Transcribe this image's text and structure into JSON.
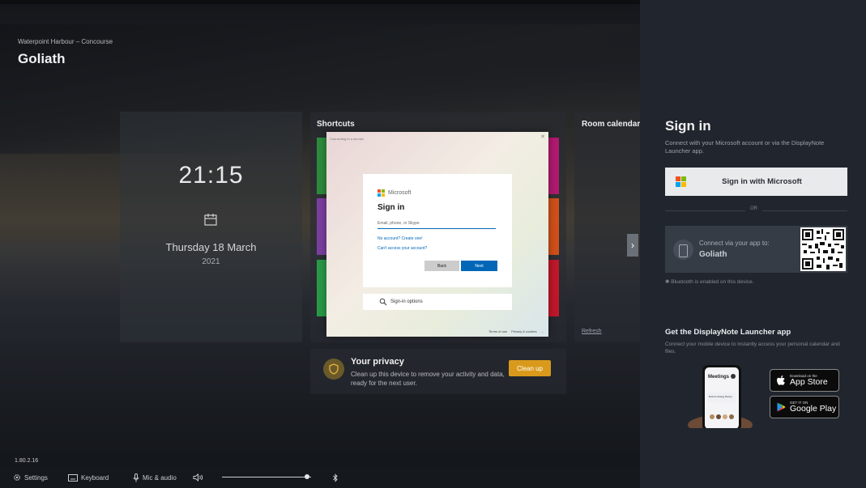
{
  "location": "Waterpoint Harbour – Concourse",
  "room_name": "Goliath",
  "clock": {
    "time": "21:15",
    "date": "Thursday 18 March",
    "year": "2021"
  },
  "shortcuts": {
    "title": "Shortcuts",
    "tile_colors": [
      "#2e8b3d",
      "#7b3fa0",
      "#2a9a48",
      "#b01a70",
      "#d0501a",
      "#c0182a"
    ]
  },
  "room_calendar": {
    "title": "Room calendar",
    "refresh": "Refresh"
  },
  "privacy": {
    "title": "Your privacy",
    "text": "Clean up this device to remove your activity and data, ready for the next user.",
    "button": "Clean up"
  },
  "version": "1.80.2.16",
  "bottombar": {
    "settings": "Settings",
    "keyboard": "Keyboard",
    "mic": "Mic & audio"
  },
  "volume_level": 0.95,
  "dialog": {
    "title": "Connecting to a service",
    "brand": "Microsoft",
    "heading": "Sign in",
    "input_placeholder": "Email, phone, or Skype",
    "no_account": "No account? Create one!",
    "cant_access": "Can't access your account?",
    "back": "Back",
    "next": "Next",
    "signin_options": "Sign-in options",
    "terms": "Terms of use",
    "privacy": "Privacy & cookies",
    "more": "..."
  },
  "panel": {
    "title": "Sign in",
    "subtitle": "Connect with your Microsoft account or via the DisplayNote Launcher app.",
    "ms_button": "Sign in with Microsoft",
    "or": "OR",
    "connect_text": "Connect via your app to:",
    "connect_room": "Goliath",
    "bluetooth_note": "Bluetooth is enabled on this device.",
    "app_title": "Get the DisplayNote Launcher app",
    "app_subtitle": "Connect your mobile device to instantly access your personal calendar and files.",
    "appstore_small": "Download on the",
    "appstore_big": "App Store",
    "googleplay_small": "GET IT ON",
    "googleplay_big": "Google Play",
    "mock_title": "Meetings",
    "mock_event": "Business Strategy Meeting"
  },
  "colors": {
    "ms_red": "#f25022",
    "ms_green": "#7fba00",
    "ms_blue": "#00a4ef",
    "ms_yellow": "#ffb900",
    "accent": "#0067b8",
    "privacy_button": "#d99a1c"
  }
}
